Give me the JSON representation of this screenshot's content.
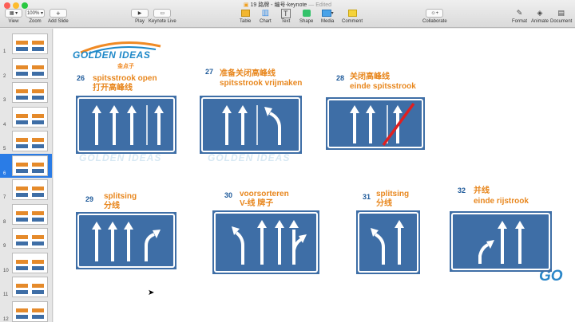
{
  "window": {
    "title": "19 路牌 - 编号-keynote",
    "edited": "— Edited"
  },
  "toolbar": {
    "view": "View",
    "zoom_value": "100%",
    "zoom": "Zoom",
    "add_slide": "Add Slide",
    "play": "Play",
    "keynote_live": "Keynote Live",
    "table": "Table",
    "chart": "Chart",
    "text": "Text",
    "shape": "Shape",
    "media": "Media",
    "comment": "Comment",
    "collaborate": "Collaborate",
    "format": "Format",
    "animate": "Animate",
    "document": "Document"
  },
  "sidebar": {
    "selected": 6,
    "slides": [
      "1",
      "2",
      "3",
      "4",
      "5",
      "6",
      "7",
      "8",
      "9",
      "10",
      "11",
      "12"
    ]
  },
  "slide": {
    "logo_text": "GOLDEN IDEAS",
    "logo_cn": "金点子",
    "corner_logo": "GO",
    "signs": [
      {
        "num": "26",
        "line1": "spitsstrook open",
        "line2": "打开高峰线"
      },
      {
        "num": "27",
        "line1": "准备关闭高峰线",
        "line2": "spitsstrook vrijmaken"
      },
      {
        "num": "28",
        "line1": "关闭高峰线",
        "line2": "einde spitsstrook"
      },
      {
        "num": "29",
        "line1": "splitsing",
        "line2": "分线"
      },
      {
        "num": "30",
        "line1": "voorsorteren",
        "line2": "V-线 牌子"
      },
      {
        "num": "31",
        "line1": "splitsing",
        "line2": "分线"
      },
      {
        "num": "32",
        "line1": "并线",
        "line2": "einde rijstrook"
      }
    ]
  },
  "colors": {
    "sign_blue": "#3e6ea6",
    "label_orange": "#e8871e",
    "number_blue": "#1e5a9a",
    "selection": "#2a7ce6",
    "cross_red": "#e02020"
  },
  "icons": [
    "view-icon",
    "add-slide-icon",
    "play-icon",
    "keynote-live-icon",
    "table-icon",
    "chart-icon",
    "text-icon",
    "shape-icon",
    "media-icon",
    "comment-icon",
    "collaborate-icon",
    "format-icon",
    "animate-icon",
    "document-icon"
  ]
}
